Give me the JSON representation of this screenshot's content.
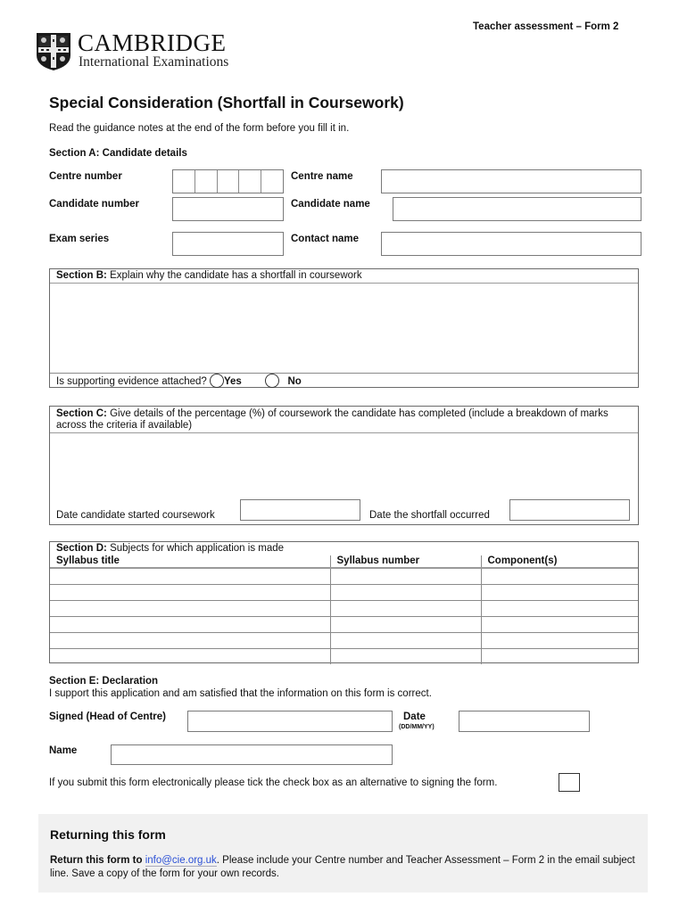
{
  "header": {
    "form_tag": "Teacher assessment – Form 2",
    "logo_title": "CAMBRIDGE",
    "logo_subtitle": "International Examinations",
    "logo_icon": "university-crest-icon"
  },
  "page_title": "Special Consideration (Shortfall in Coursework)",
  "guidance": "Read the guidance notes at the end of the form before you fill it in.",
  "section_a": {
    "title": "Section A: Candidate details",
    "centre_number_label": "Centre number",
    "centre_number_cells": [
      "",
      "",
      "",
      "",
      ""
    ],
    "centre_name_label": "Centre name",
    "centre_name_value": "",
    "candidate_number_label": "Candidate number",
    "candidate_number_value": "",
    "candidate_name_label": "Candidate name",
    "candidate_name_value": "",
    "exam_series_label": "Exam series",
    "exam_series_value": "",
    "contact_name_label": "Contact name",
    "contact_name_value": ""
  },
  "section_b": {
    "title_bold": "Section B:",
    "title_rest": " Explain why the candidate has a shortfall in coursework",
    "explanation_value": "",
    "evidence_question": "Is supporting evidence attached?",
    "yes_label": "Yes",
    "no_label": "No"
  },
  "section_c": {
    "title_bold": "Section C:",
    "title_rest": " Give details of the percentage (%) of coursework the candidate has completed (include a breakdown of marks across the criteria if available)",
    "details_value": "",
    "date_started_label": "Date candidate started coursework",
    "date_started_value": "",
    "date_shortfall_label": "Date the shortfall occurred",
    "date_shortfall_value": ""
  },
  "section_d": {
    "title_bold": "Section D:",
    "title_rest": " Subjects for which application is made",
    "columns": [
      "Syllabus title",
      "Syllabus number",
      "Component(s)"
    ],
    "rows": [
      [
        "",
        "",
        ""
      ],
      [
        "",
        "",
        ""
      ],
      [
        "",
        "",
        ""
      ],
      [
        "",
        "",
        ""
      ],
      [
        "",
        "",
        ""
      ],
      [
        "",
        "",
        ""
      ]
    ]
  },
  "section_e": {
    "title": "Section E: Declaration",
    "statement": "I support this application and am satisfied that the information on this form is correct.",
    "signed_label": "Signed (Head of Centre)",
    "signed_value": "",
    "date_label": "Date",
    "date_format": "(DD/MM/YY)",
    "date_value": "",
    "name_label": "Name",
    "name_value": "",
    "electronic_note": "If you submit this form electronically please tick the check box as an alternative to signing the form."
  },
  "returning": {
    "title": "Returning this form",
    "lead_bold": "Return this form to",
    "email": "info@cie.org.uk",
    "rest": ". Please include your Centre number and Teacher Assessment – Form 2 in the email subject line. Save a copy of the form for your own records."
  }
}
